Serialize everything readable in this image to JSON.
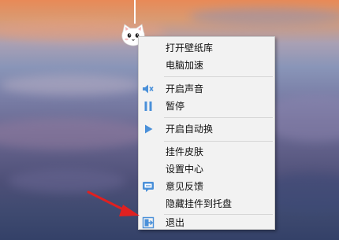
{
  "context_menu": {
    "items": [
      {
        "label": "打开壁纸库",
        "icon": ""
      },
      {
        "label": "电脑加速",
        "icon": ""
      },
      {
        "label": "开启声音",
        "icon": "mute-speaker-icon"
      },
      {
        "label": "暂停",
        "icon": "pause-icon"
      },
      {
        "label": "开启自动换",
        "icon": "play-icon"
      },
      {
        "label": "挂件皮肤",
        "icon": ""
      },
      {
        "label": "设置中心",
        "icon": ""
      },
      {
        "label": "意见反馈",
        "icon": "feedback-icon"
      },
      {
        "label": "隐藏挂件到托盘",
        "icon": ""
      },
      {
        "label": "退出",
        "icon": "exit-icon"
      }
    ]
  },
  "widget": {
    "icon": "cat-pendant-icon"
  },
  "annotation": {
    "icon": "red-arrow-icon"
  },
  "colors": {
    "accent": "#4a90d9",
    "arrow": "#e02020",
    "menu_bg": "#f2f2f2"
  }
}
